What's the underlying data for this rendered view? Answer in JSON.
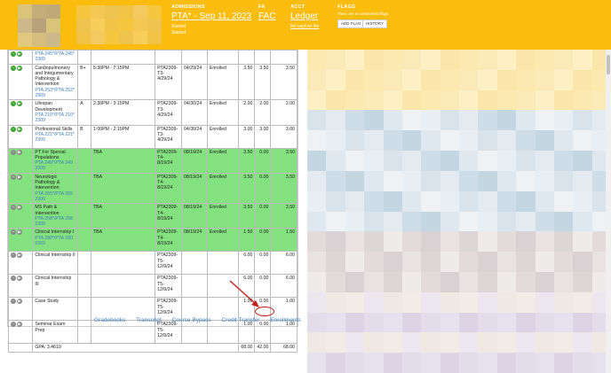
{
  "header": {
    "admissions_label": "ADMISSIONS",
    "program_link": "PTA* - Sep 11, 2023",
    "status_1": "Started",
    "status_2": "Started",
    "fa_label": "FA",
    "fa_link": "FAC",
    "acct_label": "ACCT",
    "ledger_link": "Ledger",
    "no_card": "No card on file",
    "flags_label": "FLAGS",
    "flags_msg": "There are no unresolved flags",
    "add_flag_btn": "ADD FLAG",
    "history_btn": "HISTORY"
  },
  "rows": [
    {
      "course": "",
      "course_link": "PTA 245*/PTA 245* 2309",
      "grade": "",
      "time": "",
      "section": "",
      "date": "",
      "status": "",
      "att": "",
      "earned": "",
      "cr": "",
      "icons": [
        "green",
        "green"
      ],
      "highlight": false
    },
    {
      "course": "Cardiopulmonary and Integumentary Pathology & Intervention",
      "course_link": "PTA 253*/PTA 253* 2309",
      "grade": "B+",
      "time": "5:30PM - 7:15PM",
      "section": "PTA2309-T3-4/29/24",
      "date": "04/29/24",
      "status": "Enrolled",
      "att": "3.50",
      "earned": "3.50",
      "cr": "3.50",
      "icons": [
        "green",
        "green"
      ],
      "highlight": false
    },
    {
      "course": "Lifespan Development",
      "course_link": "PTA 210*/PTA 210* 2309",
      "grade": "A",
      "time": "2:30PM - 3:15PM",
      "section": "PTA2309-T3-4/29/24",
      "date": "04/30/24",
      "status": "Enrolled",
      "att": "2.00",
      "earned": "2.00",
      "cr": "2.00",
      "icons": [
        "green",
        "green"
      ],
      "highlight": false
    },
    {
      "course": "Professional Skills",
      "course_link": "PTA 221*/PTA 221* 2309",
      "grade": "B",
      "time": "1:00PM - 2:15PM",
      "section": "PTA2309-T3-4/29/24",
      "date": "04/30/24",
      "status": "Enrolled",
      "att": "3.00",
      "earned": "3.00",
      "cr": "3.00",
      "icons": [
        "green",
        "green"
      ],
      "highlight": false
    },
    {
      "course": "PT For Special Populations",
      "course_link": "PTA 249*/PTA 249 2309",
      "grade": "",
      "time": "TBA",
      "section": "PTA2309-T4-8/19/24",
      "date": "08/19/24",
      "status": "Enrolled",
      "att": "3.50",
      "earned": "0.00",
      "cr": "3.50",
      "icons": [
        "gray",
        "gray"
      ],
      "highlight": true
    },
    {
      "course": "Neurologic Pathology & Intervention",
      "course_link": "PTA 255*/PTA 255 2309",
      "grade": "",
      "time": "TBA",
      "section": "PTA2309-T4-8/19/24",
      "date": "08/19/24",
      "status": "Enrolled",
      "att": "3.50",
      "earned": "0.00",
      "cr": "3.50",
      "icons": [
        "gray",
        "gray"
      ],
      "highlight": true
    },
    {
      "course": "MS Path & Intervention",
      "course_link": "PTA 258*/PTA 258 2309",
      "grade": "",
      "time": "TBA",
      "section": "PTA2309-T4-8/19/24",
      "date": "08/19/24",
      "status": "Enrolled",
      "att": "3.50",
      "earned": "0.00",
      "cr": "3.50",
      "icons": [
        "gray",
        "gray"
      ],
      "highlight": true
    },
    {
      "course": "Clinical Internship I",
      "course_link": "PTA 280*/PTA 280 2309",
      "grade": "",
      "time": "TBA",
      "section": "PTA2309-T4-8/19/24",
      "date": "08/19/24",
      "status": "Enrolled",
      "att": "1.50",
      "earned": "0.00",
      "cr": "1.50",
      "icons": [
        "gray",
        "gray"
      ],
      "highlight": true
    },
    {
      "course": "Clinical Internship II",
      "course_link": "",
      "grade": "",
      "time": "",
      "section": "PTA2309-T5-12/9/24",
      "date": "",
      "status": "",
      "att": "6.00",
      "earned": "0.00",
      "cr": "6.00",
      "icons": [
        "gray",
        "gray"
      ],
      "highlight": false
    },
    {
      "course": "Clinical Internship III",
      "course_link": "",
      "grade": "",
      "time": "",
      "section": "PTA2309-T5-12/9/24",
      "date": "",
      "status": "",
      "att": "6.00",
      "earned": "0.00",
      "cr": "6.00",
      "icons": [
        "gray",
        "gray"
      ],
      "highlight": false
    },
    {
      "course": "Case Study",
      "course_link": "",
      "grade": "",
      "time": "",
      "section": "PTA2309-T5-12/9/24",
      "date": "",
      "status": "",
      "att": "1.00",
      "earned": "0.00",
      "cr": "1.00",
      "icons": [
        "gray",
        "gray"
      ],
      "highlight": false
    },
    {
      "course": "Seminar Exam Prep",
      "course_link": "",
      "grade": "",
      "time": "",
      "section": "PTA2309-T5-12/9/24",
      "date": "",
      "status": "",
      "att": "1.00",
      "earned": "0.00",
      "cr": "1.00",
      "icons": [
        "gray",
        "gray"
      ],
      "highlight": false
    }
  ],
  "totals": {
    "gpa": "GPA: 3.4619",
    "att": "68.00",
    "earned": "42.00",
    "cr": "68.00"
  },
  "footer_links": [
    "Gradebooks",
    "Transcript",
    "Course Bypass",
    "Credit Transfer",
    "Enrollments"
  ],
  "colors": {
    "header": "#fbbd0d",
    "highlight_row": "#83e17f",
    "link": "#3d7fc1",
    "annotation": "#c0201a"
  }
}
